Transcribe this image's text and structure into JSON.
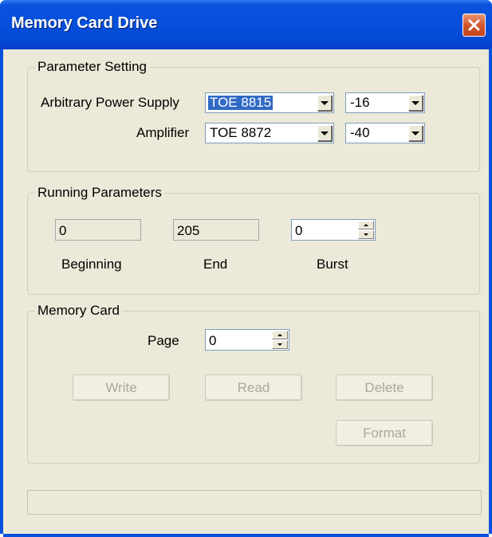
{
  "window": {
    "title": "Memory Card Drive"
  },
  "parameter_setting": {
    "legend": "Parameter Setting",
    "arbitrary_power_supply": {
      "label": "Arbitrary Power Supply",
      "model": "TOE 8815",
      "level": "-16"
    },
    "amplifier": {
      "label": "Amplifier",
      "model": "TOE 8872",
      "level": "-40"
    }
  },
  "running_parameters": {
    "legend": "Running Parameters",
    "beginning": {
      "label": "Beginning",
      "value": "0"
    },
    "end": {
      "label": "End",
      "value": "205"
    },
    "burst": {
      "label": "Burst",
      "value": "0"
    }
  },
  "memory_card": {
    "legend": "Memory Card",
    "page": {
      "label": "Page",
      "value": "0"
    },
    "buttons": {
      "write": "Write",
      "read": "Read",
      "delete": "Delete",
      "format": "Format"
    }
  },
  "colors": {
    "title_bar": "#0550dc",
    "close_button": "#d1582e",
    "dialog_bg": "#ece9d8",
    "selection": "#316ac5"
  },
  "icons": {
    "close": "close-icon",
    "dropdown": "chevron-down-icon",
    "spinner": "spin-arrows-icon"
  }
}
